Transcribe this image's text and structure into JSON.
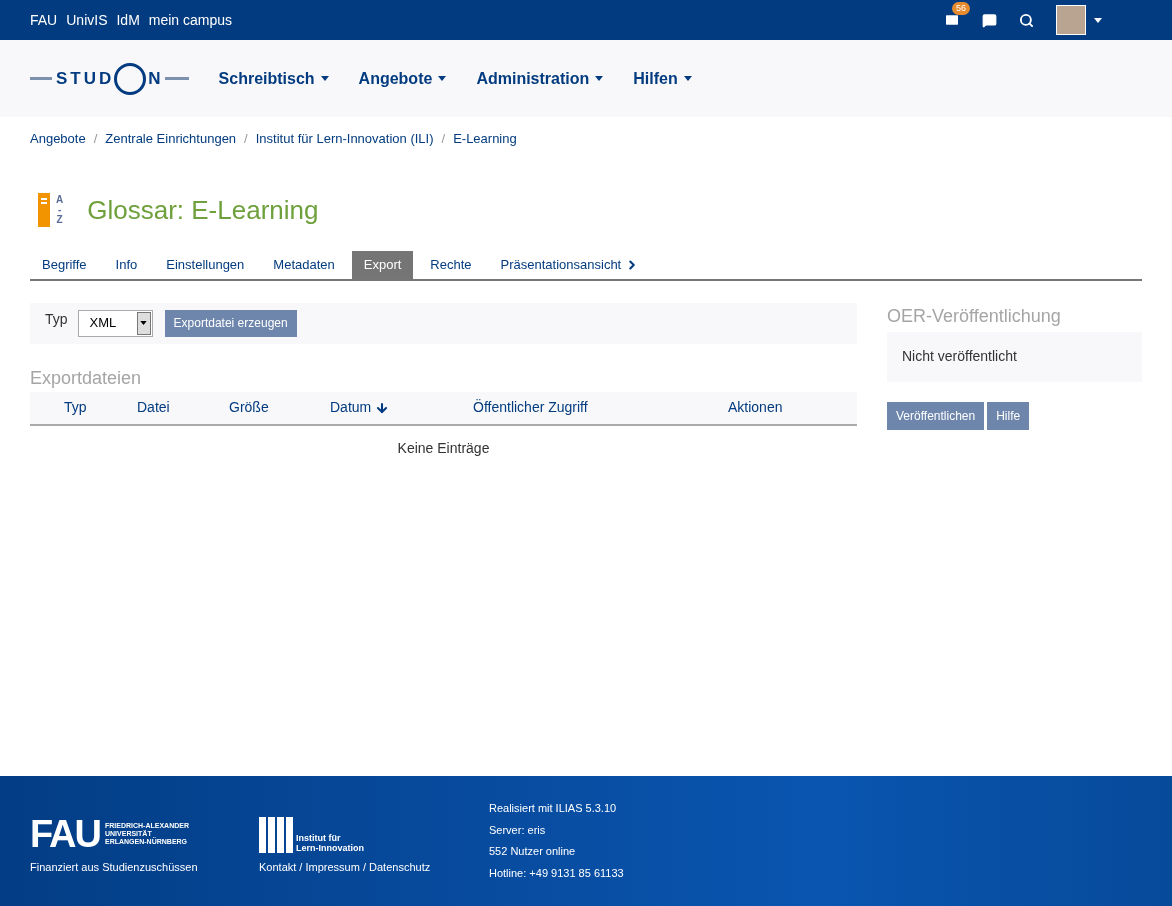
{
  "top_bar": {
    "links": [
      "FAU",
      "UnivIS",
      "IdM",
      "mein campus"
    ],
    "mail_badge": "56"
  },
  "nav": {
    "logo": {
      "left": "STUD",
      "right": "N"
    },
    "menus": [
      "Schreibtisch",
      "Angebote",
      "Administration",
      "Hilfen"
    ]
  },
  "breadcrumb_separator": "/",
  "breadcrumbs": [
    "Angebote",
    "Zentrale Einrichtungen",
    "Institut für Lern-Innovation (ILI)",
    "E-Learning"
  ],
  "header": {
    "icon_letters": [
      "A",
      "-",
      "Z"
    ],
    "title": "Glossar: E-Learning"
  },
  "tabs": [
    {
      "label": "Begriffe",
      "selected": false
    },
    {
      "label": "Info",
      "selected": false
    },
    {
      "label": "Einstellungen",
      "selected": false
    },
    {
      "label": "Metadaten",
      "selected": false
    },
    {
      "label": "Export",
      "selected": true
    },
    {
      "label": "Rechte",
      "selected": false
    },
    {
      "label": "Präsentationsansicht",
      "selected": false,
      "kind": "more"
    }
  ],
  "export_toolbar": {
    "label": "Typ",
    "type_value": "XML",
    "button": "Exportdatei erzeugen"
  },
  "export_files": {
    "title": "Exportdateien",
    "columns": [
      {
        "label": "Typ"
      },
      {
        "label": "Datei"
      },
      {
        "label": "Größe"
      },
      {
        "label": "Datum",
        "sorted": true
      },
      {
        "label": "Öffentlicher Zugriff"
      },
      {
        "label": "Aktionen"
      }
    ],
    "empty": "Keine Einträge"
  },
  "oer": {
    "title": "OER-Veröffentlichung",
    "status": "Nicht veröffentlicht",
    "buttons": [
      "Veröffentlichen",
      "Hilfe"
    ]
  },
  "footer": {
    "fau_logo": {
      "mark": "FAU",
      "lines": [
        "FRIEDRICH-ALEXANDER",
        "UNIVERSITÄT",
        "ERLANGEN-NÜRNBERG"
      ]
    },
    "funding": "Finanziert aus Studienzuschüssen",
    "ili_logo": [
      "Institut für",
      "Lern-Innovation"
    ],
    "links": "Kontakt / Impressum / Datenschutz",
    "info": [
      "Realisiert mit ILIAS 5.3.10",
      "Server: eris",
      "552 Nutzer online",
      "Hotline: +49 9131 85 61133"
    ]
  }
}
